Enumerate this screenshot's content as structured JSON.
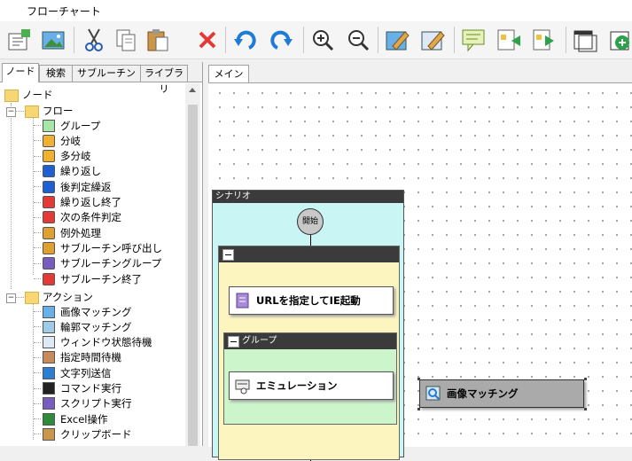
{
  "window": {
    "title": "フローチャート"
  },
  "toolbar": {
    "buttons": [
      "new-flow",
      "image",
      "cut",
      "copy",
      "paste",
      "delete",
      "undo",
      "redo",
      "zoom-in",
      "zoom-out",
      "edit-node",
      "edit-node-2",
      "comment",
      "import",
      "export",
      "export-alt",
      "new-window",
      "add"
    ]
  },
  "left_panel": {
    "tabs": [
      "ノード",
      "検索",
      "サブルーチン",
      "ライブラリ"
    ],
    "active_tab": "ノード",
    "tree": {
      "root": "ノード",
      "flow": {
        "label": "フロー",
        "items": [
          "グループ",
          "分岐",
          "多分岐",
          "繰り返し",
          "後判定繰返",
          "繰り返し終了",
          "次の条件判定",
          "例外処理",
          "サブルーチン呼び出し",
          "サブルーチングループ",
          "サブルーチン終了"
        ]
      },
      "action": {
        "label": "アクション",
        "items": [
          "画像マッチング",
          "輪郭マッチング",
          "ウィンドウ状態待機",
          "指定時間待機",
          "文字列送信",
          "コマンド実行",
          "スクリプト実行",
          "Excel操作",
          "クリップボード"
        ]
      }
    }
  },
  "canvas": {
    "tab": "メイン",
    "scenario_label": "シナリオ",
    "start_label": "開始",
    "group_label": "グループ",
    "action1": "URLを指定してIE起動",
    "action2": "エミュレーション",
    "floating_node": "画像マッチング"
  },
  "colors": {
    "scenario_bg": "#c9f6f4",
    "group_outer_bg": "#fdf5c0",
    "group_inner_bg": "#ccf5cc",
    "header_dark": "#3b3b3b",
    "selected_node": "#aaaaaa"
  }
}
